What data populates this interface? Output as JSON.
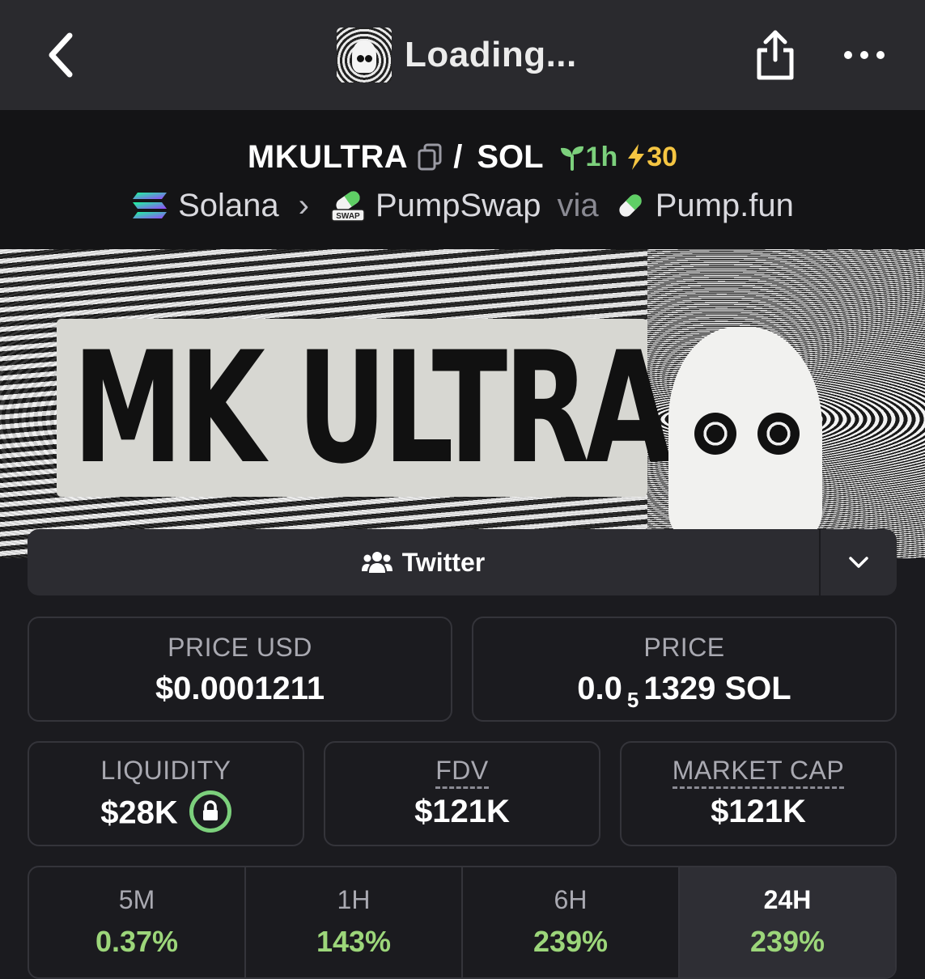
{
  "topbar": {
    "title": "Loading..."
  },
  "pair": {
    "base": "MKULTRA",
    "separator": "/",
    "quote": "SOL",
    "age": "1h",
    "boosts": "30"
  },
  "route": {
    "chain": "Solana",
    "dex": "PumpSwap",
    "dex_badge": "SWAP",
    "via": "via",
    "launchpad": "Pump.fun"
  },
  "banner": {
    "text": "MK ULTRA"
  },
  "links": {
    "twitter_label": "Twitter"
  },
  "stats": {
    "price_usd_label": "PRICE USD",
    "price_usd_value": "$0.0001211",
    "price_label": "PRICE",
    "price_prefix": "0.0",
    "price_subscript": "5",
    "price_suffix": "1329 SOL",
    "liquidity_label": "LIQUIDITY",
    "liquidity_value": "$28K",
    "fdv_label": "FDV",
    "fdv_value": "$121K",
    "mcap_label": "MARKET CAP",
    "mcap_value": "$121K"
  },
  "periods": [
    {
      "label": "5M",
      "value": "0.37%"
    },
    {
      "label": "1H",
      "value": "143%"
    },
    {
      "label": "6H",
      "value": "239%"
    },
    {
      "label": "24H",
      "value": "239%"
    }
  ],
  "colors": {
    "positive": "#9cd67a",
    "age": "#7cd07c",
    "boost": "#f5c542",
    "card_border": "#34343a"
  }
}
